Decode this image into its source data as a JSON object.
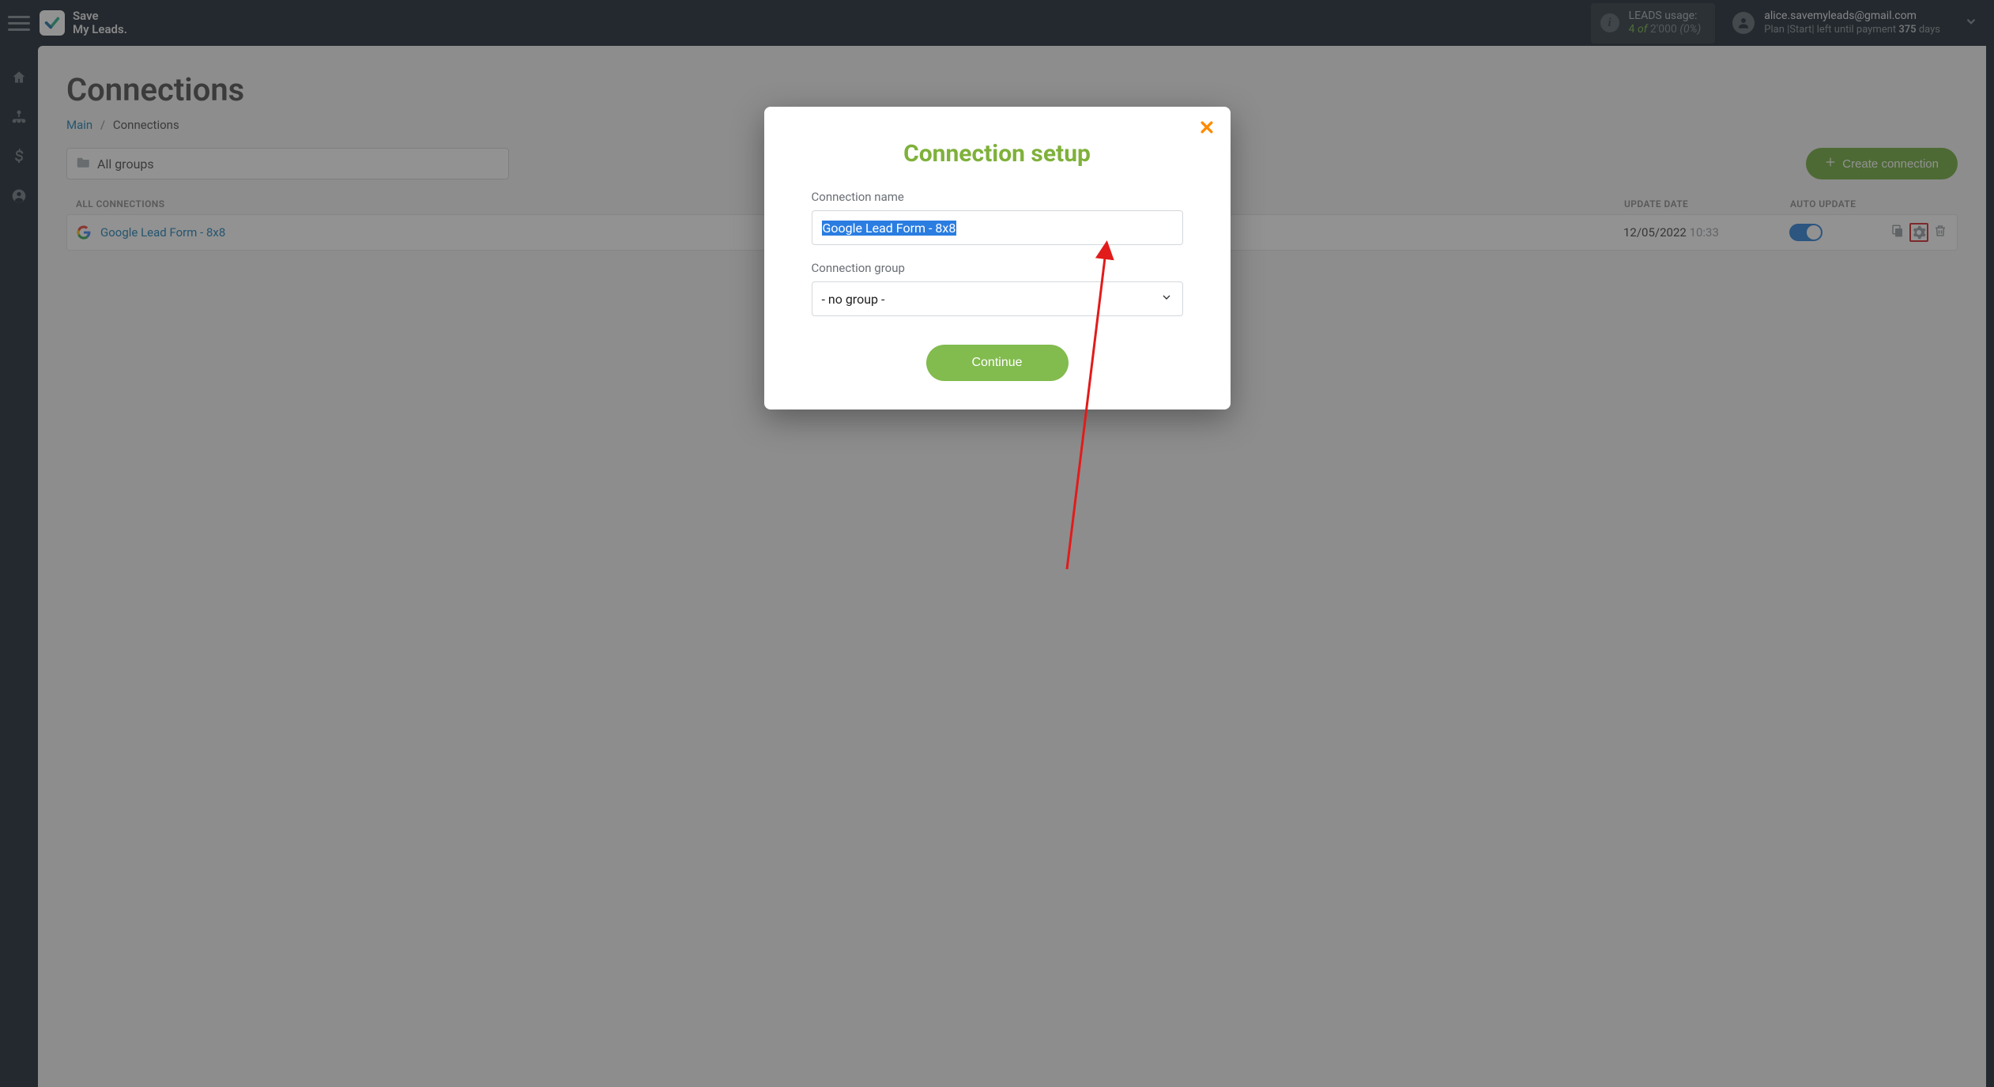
{
  "header": {
    "brand_line1": "Save",
    "brand_line2": "My Leads.",
    "usage_label": "LEADS usage:",
    "usage_count": "4",
    "usage_of": "of",
    "usage_total": "2'000",
    "usage_pct": "(0%)",
    "email": "alice.savemyleads@gmail.com",
    "plan_prefix": "Plan |",
    "plan_name": "Start",
    "plan_mid": "| left until payment ",
    "plan_days": "375",
    "plan_suffix": " days"
  },
  "page": {
    "title": "Connections",
    "breadcrumb_main": "Main",
    "breadcrumb_here": "Connections",
    "group_select": "All groups",
    "create_btn": "Create connection"
  },
  "table": {
    "head_all": "ALL CONNECTIONS",
    "head_update": "UPDATE DATE",
    "head_auto": "AUTO UPDATE",
    "row": {
      "name": "Google Lead Form - 8x8",
      "date": "12/05/2022",
      "time": "10:33"
    }
  },
  "modal": {
    "title": "Connection setup",
    "name_label": "Connection name",
    "name_value": "Google Lead Form - 8x8",
    "group_label": "Connection group",
    "group_value": "- no group -",
    "continue": "Continue"
  }
}
